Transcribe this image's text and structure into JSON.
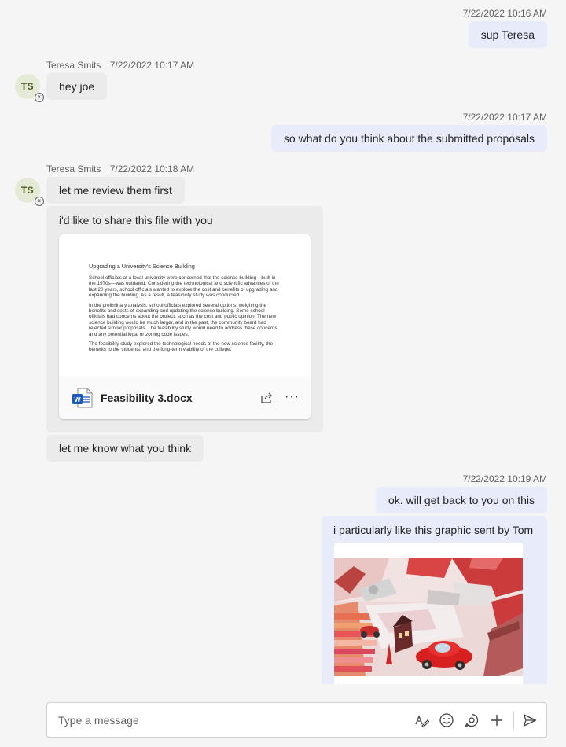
{
  "conversation": {
    "messages": [
      {
        "timestamp": "7/22/2022 10:16 AM",
        "text": "sup Teresa"
      },
      {
        "sender": "Teresa Smits",
        "timestamp": "7/22/2022 10:17 AM",
        "text": "hey joe"
      },
      {
        "timestamp": "7/22/2022 10:17 AM",
        "text": "so what do you think about the submitted proposals"
      },
      {
        "sender": "Teresa Smits",
        "timestamp": "7/22/2022 10:18 AM",
        "text": "let me review them first"
      },
      {
        "text": "i'd like to share this file with you"
      },
      {
        "text": "let me know what you think"
      },
      {
        "timestamp": "7/22/2022 10:19 AM",
        "text": "ok. will get back to you on this"
      },
      {
        "text": "i particularly like this graphic sent by Tom"
      }
    ],
    "avatar_initials": "TS",
    "status_glyph": "×"
  },
  "file": {
    "name": "Feasibility 3.docx",
    "icon": "word-doc-icon",
    "preview_title": "Upgrading a University's Science Building",
    "preview_paragraphs": [
      "School officials at a local university were concerned that the science building—built in the 1970s—was outdated. Considering the technological and scientific advances of the last 20 years, school officials wanted to explore the cost and benefits of upgrading and expanding the building. As a result, a feasibility study was conducted.",
      "In the preliminary analysis, school officials explored several options, weighing the benefits and costs of expanding and updating the science building. Some school officials had concerns about the project, such as the cost and public opinion. The new science building would be much larger, and in the past, the community board had rejected similar proposals. The feasibility study would need to address these concerns and any potential legal or zoning code issues.",
      "The feasibility study explored the technological needs of the new science facility, the benefits to the students, and the long-term viability of the college."
    ],
    "more_glyph": "···"
  },
  "compose": {
    "placeholder": "Type a message"
  },
  "colors": {
    "outgoing_bubble": "#e8ebfa",
    "incoming_bubble": "#ebebeb",
    "background": "#f5f5f5",
    "word_blue": "#185abd"
  }
}
